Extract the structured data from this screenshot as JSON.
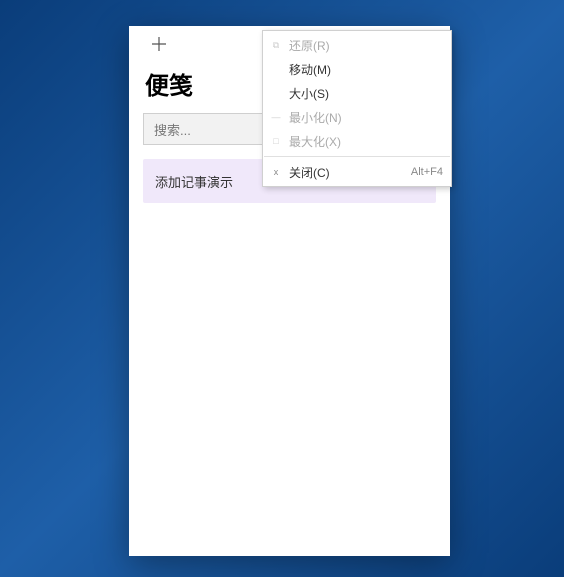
{
  "app": {
    "title": "便笺"
  },
  "search": {
    "placeholder": "搜索..."
  },
  "note": {
    "text": "添加记事演示"
  },
  "contextMenu": {
    "restore": "还原(R)",
    "move": "移动(M)",
    "size": "大小(S)",
    "minimize": "最小化(N)",
    "maximize": "最大化(X)",
    "close": "关闭(C)",
    "closeShortcut": "Alt+F4"
  }
}
